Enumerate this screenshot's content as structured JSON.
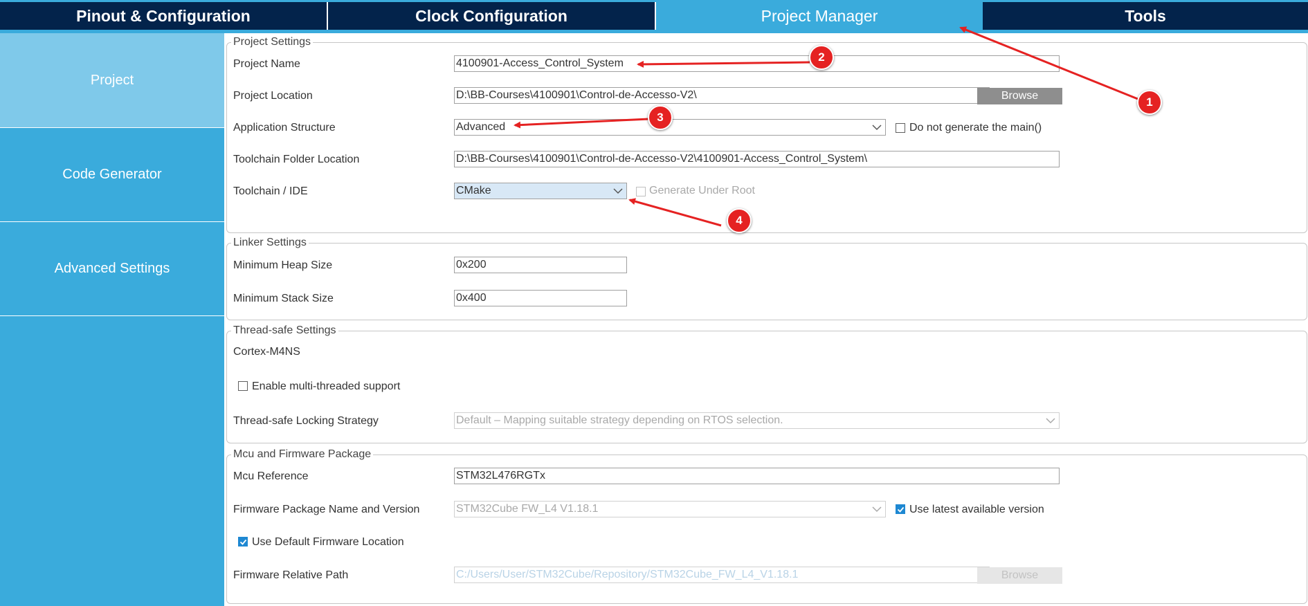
{
  "tabs": [
    {
      "label": "Pinout & Configuration"
    },
    {
      "label": "Clock Configuration"
    },
    {
      "label": "Project Manager"
    },
    {
      "label": "Tools"
    }
  ],
  "sidebar": {
    "items": [
      {
        "label": "Project"
      },
      {
        "label": "Code Generator"
      },
      {
        "label": "Advanced Settings"
      }
    ]
  },
  "project_settings": {
    "legend": "Project Settings",
    "project_name_label": "Project Name",
    "project_name_value": "4100901-Access_Control_System",
    "project_location_label": "Project Location",
    "project_location_value": "D:\\BB-Courses\\4100901\\Control-de-Accesso-V2\\",
    "browse_label": "Browse",
    "app_structure_label": "Application Structure",
    "app_structure_value": "Advanced",
    "do_not_generate_main_label": "Do not generate the main()",
    "toolchain_folder_label": "Toolchain Folder Location",
    "toolchain_folder_value": "D:\\BB-Courses\\4100901\\Control-de-Accesso-V2\\4100901-Access_Control_System\\",
    "toolchain_ide_label": "Toolchain / IDE",
    "toolchain_ide_value": "CMake",
    "generate_under_root_label": "Generate Under Root"
  },
  "linker_settings": {
    "legend": "Linker Settings",
    "min_heap_label": "Minimum Heap Size",
    "min_heap_value": "0x200",
    "min_stack_label": "Minimum Stack Size",
    "min_stack_value": "0x400"
  },
  "thread_safe": {
    "legend": "Thread-safe Settings",
    "core_label": "Cortex-M4NS",
    "enable_mt_label": "Enable multi-threaded support",
    "locking_label": "Thread-safe Locking Strategy",
    "locking_value": "Default – Mapping suitable strategy depending on RTOS selection."
  },
  "mcu_fw": {
    "legend": "Mcu and Firmware Package",
    "mcu_ref_label": "Mcu Reference",
    "mcu_ref_value": "STM32L476RGTx",
    "fw_pkg_label": "Firmware Package Name and Version",
    "fw_pkg_value": "STM32Cube FW_L4 V1.18.1",
    "use_latest_label": "Use latest available version",
    "use_default_fw_label": "Use Default Firmware Location",
    "fw_rel_path_label": "Firmware Relative Path",
    "fw_rel_path_value": "C:/Users/User/STM32Cube/Repository/STM32Cube_FW_L4_V1.18.1",
    "browse_label": "Browse"
  },
  "annotations": [
    {
      "label": "1"
    },
    {
      "label": "2"
    },
    {
      "label": "3"
    },
    {
      "label": "4"
    }
  ],
  "colors": {
    "tab_dark": "#03234b",
    "accent": "#3aabdc",
    "sidebar_selected": "#7fc9ea",
    "annotation_red": "#e52222",
    "checkbox_checked": "#1e88d2"
  }
}
